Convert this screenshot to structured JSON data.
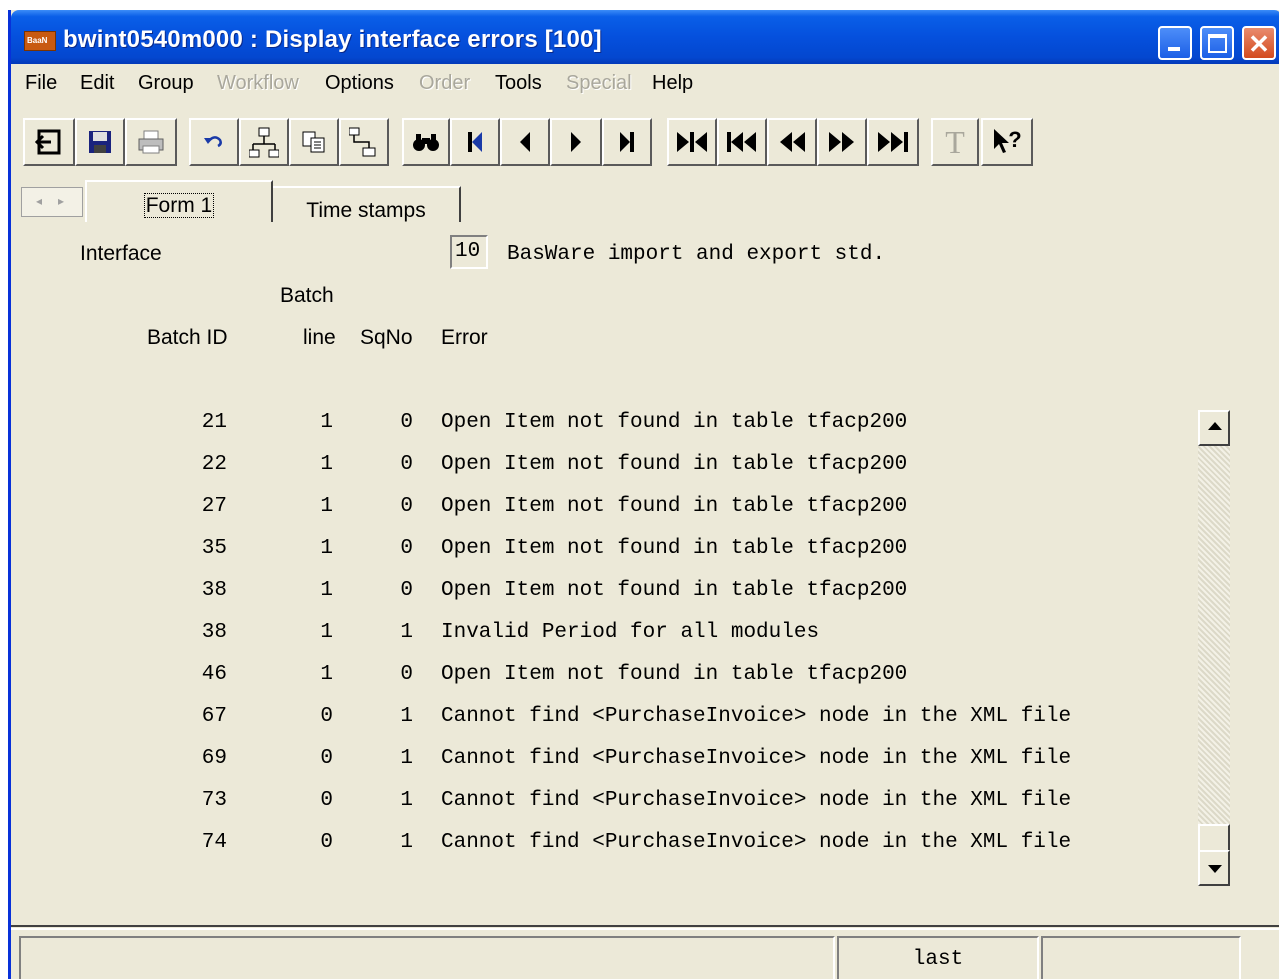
{
  "window": {
    "title": "bwint0540m000 : Display interface errors [100]",
    "app_icon_text": "BaaN"
  },
  "menu": [
    {
      "label": "File",
      "enabled": true
    },
    {
      "label": "Edit",
      "enabled": true
    },
    {
      "label": "Group",
      "enabled": true
    },
    {
      "label": "Workflow",
      "enabled": false
    },
    {
      "label": "Options",
      "enabled": true
    },
    {
      "label": "Order",
      "enabled": false
    },
    {
      "label": "Tools",
      "enabled": true
    },
    {
      "label": "Special",
      "enabled": false
    },
    {
      "label": "Help",
      "enabled": true
    }
  ],
  "toolbar": [
    "exit-icon",
    "save-icon",
    "print-icon",
    "undo-icon",
    "insert-icon",
    "copy-icon",
    "insert-below-icon",
    "find-icon",
    "first-record-icon",
    "previous-record-icon",
    "next-record-icon",
    "last-record-icon",
    "first-set-icon",
    "first-page-icon",
    "previous-page-icon",
    "next-page-icon",
    "last-page-icon",
    "text-icon",
    "help-icon"
  ],
  "tabs": [
    {
      "label": "Form 1",
      "active": true
    },
    {
      "label": "Time stamps",
      "active": false
    }
  ],
  "form": {
    "interface_label": "Interface",
    "interface_code": "10",
    "interface_description": "BasWare import and export std.",
    "col_batch_line_top": "Batch",
    "col_batch_id": "Batch ID",
    "col_batch_line": "line",
    "col_sqno": "SqNo",
    "col_error": "Error"
  },
  "rows": [
    {
      "batch_id": "21",
      "line": "1",
      "sqno": "0",
      "error": "Open Item not found in table tfacp200"
    },
    {
      "batch_id": "22",
      "line": "1",
      "sqno": "0",
      "error": "Open Item not found in table tfacp200"
    },
    {
      "batch_id": "27",
      "line": "1",
      "sqno": "0",
      "error": "Open Item not found in table tfacp200"
    },
    {
      "batch_id": "35",
      "line": "1",
      "sqno": "0",
      "error": "Open Item not found in table tfacp200"
    },
    {
      "batch_id": "38",
      "line": "1",
      "sqno": "0",
      "error": "Open Item not found in table tfacp200"
    },
    {
      "batch_id": "38",
      "line": "1",
      "sqno": "1",
      "error": "Invalid Period for all modules"
    },
    {
      "batch_id": "46",
      "line": "1",
      "sqno": "0",
      "error": "Open Item not found in table tfacp200"
    },
    {
      "batch_id": "67",
      "line": "0",
      "sqno": "1",
      "error": "Cannot find <PurchaseInvoice> node in the XML file"
    },
    {
      "batch_id": "69",
      "line": "0",
      "sqno": "1",
      "error": "Cannot find <PurchaseInvoice> node in the XML file"
    },
    {
      "batch_id": "73",
      "line": "0",
      "sqno": "1",
      "error": "Cannot find <PurchaseInvoice> node in the XML file"
    },
    {
      "batch_id": "74",
      "line": "0",
      "sqno": "1",
      "error": "Cannot find <PurchaseInvoice> node in the XML file"
    }
  ],
  "status": {
    "left": "",
    "middle": "last",
    "right": ""
  },
  "colors": {
    "titlebar": "#0550dd",
    "window_bg": "#ece9d8",
    "disabled_text": "#a9a79c"
  }
}
